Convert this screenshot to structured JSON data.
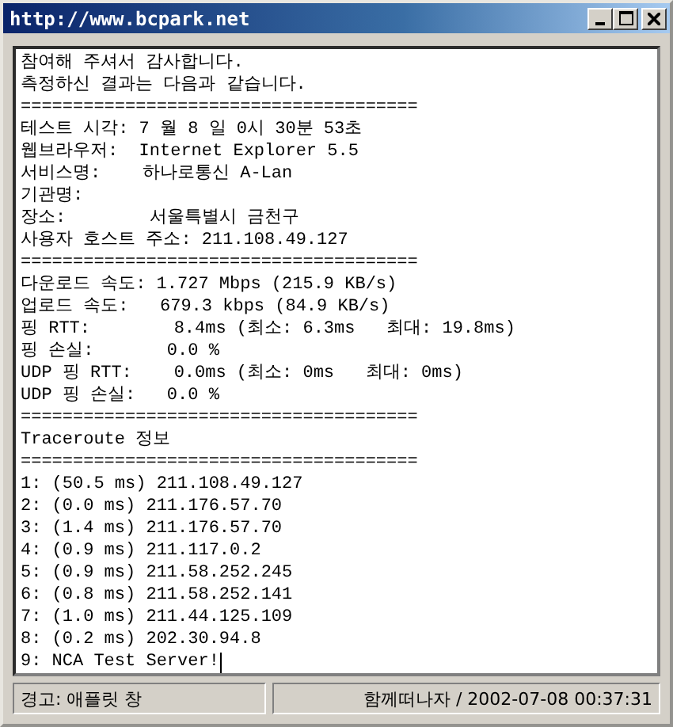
{
  "window": {
    "title": "http://www.bcpark.net"
  },
  "content": {
    "lines": [
      "참여해 주셔서 감사합니다.",
      "측정하신 결과는 다음과 같습니다.",
      "======================================",
      "테스트 시각: 7 월 8 일 0시 30분 53초",
      "웹브라우저:  Internet Explorer 5.5",
      "서비스명:    하나로통신 A-Lan",
      "기관명:",
      "장소:        서울특별시 금천구",
      "사용자 호스트 주소: 211.108.49.127",
      "======================================",
      "다운로드 속도: 1.727 Mbps (215.9 KB/s)",
      "업로드 속도:   679.3 kbps (84.9 KB/s)",
      "핑 RTT:        8.4ms (최소: 6.3ms   최대: 19.8ms)",
      "핑 손실:       0.0 %",
      "UDP 핑 RTT:    0.0ms (최소: 0ms   최대: 0ms)",
      "UDP 핑 손실:   0.0 %",
      "======================================",
      "Traceroute 정보",
      "======================================",
      "1: (50.5 ms) 211.108.49.127",
      "2: (0.0 ms) 211.176.57.70",
      "3: (1.4 ms) 211.176.57.70",
      "4: (0.9 ms) 211.117.0.2",
      "5: (0.9 ms) 211.58.252.245",
      "6: (0.8 ms) 211.58.252.141",
      "7: (1.0 ms) 211.44.125.109",
      "8: (0.2 ms) 202.30.94.8",
      "9: NCA Test Server!"
    ]
  },
  "status_bar": {
    "left": "경고: 애플릿 창",
    "right": "함께떠나자 / 2002-07-08 00:37:31"
  }
}
